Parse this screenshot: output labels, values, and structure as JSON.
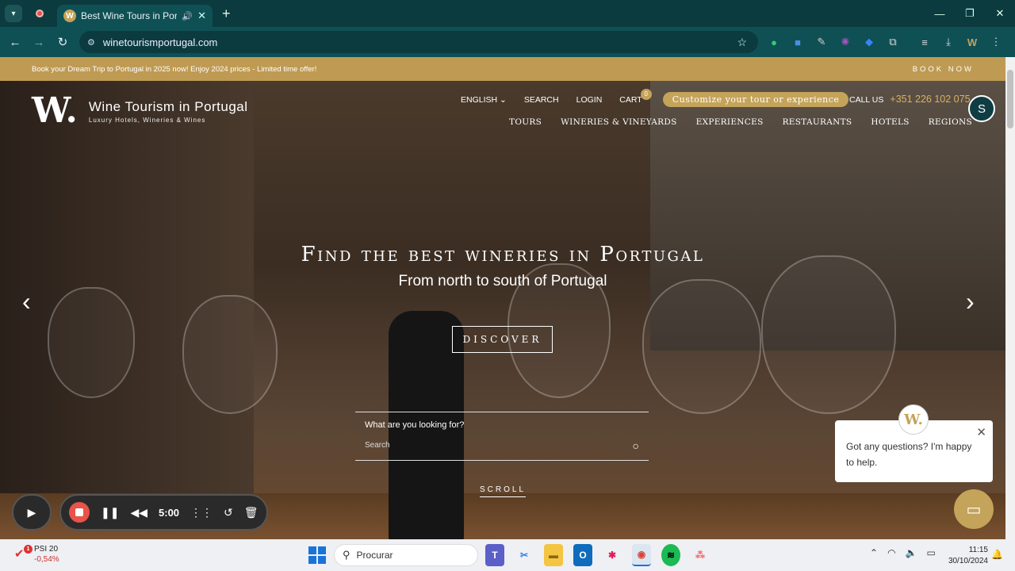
{
  "browser": {
    "tab_title": "Best Wine Tours in Portugal",
    "url": "winetourismportugal.com"
  },
  "promo": {
    "text": "Book your Dream Trip to Portugal in 2025 now! Enjoy 2024 prices - Limited time offer!",
    "book_now": "BOOK NOW"
  },
  "header": {
    "logo_mark": "W.",
    "logo_title": "Wine Tourism in Portugal",
    "logo_sub": "Luxury Hotels, Wineries & Wines",
    "top_nav": [
      "ENGLISH",
      "SEARCH",
      "LOGIN",
      "CART"
    ],
    "cart_count": "0",
    "customize": "Customize your tour or experience",
    "call_label": "CALL US",
    "phone": "+351 226 102 075",
    "main_nav": [
      "TOURS",
      "WINERIES & VINEYARDS",
      "EXPERIENCES",
      "RESTAURANTS",
      "HOTELS",
      "REGIONS"
    ]
  },
  "hero": {
    "headline": "Find the best wineries in Portugal",
    "subline": "From north to south of Portugal",
    "discover": "DISCOVER",
    "search_label": "What are you looking for?",
    "search_placeholder": "Search",
    "scroll": "SCROLL"
  },
  "chat": {
    "avatar": "W.",
    "message": "Got any questions? I'm happy to help."
  },
  "recorder": {
    "time": "5:00"
  },
  "taskbar": {
    "stock_name": "PSI 20",
    "stock_change": "-0,54%",
    "stock_badge": "1",
    "search": "Procurar",
    "time": "11:15",
    "date": "30/10/2024"
  }
}
